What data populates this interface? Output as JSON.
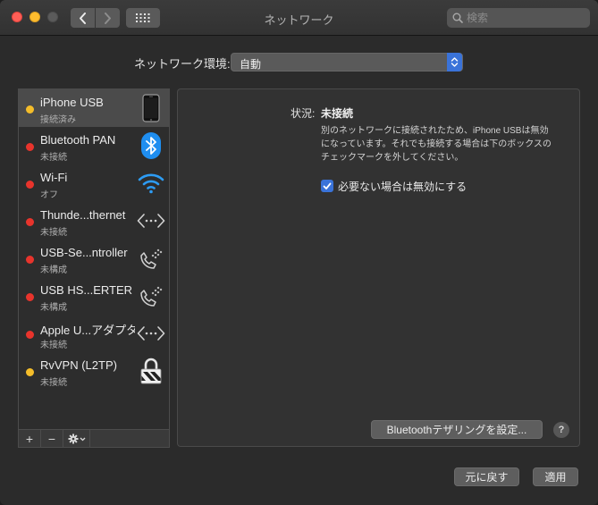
{
  "window": {
    "title": "ネットワーク"
  },
  "search": {
    "placeholder": "検索"
  },
  "location": {
    "label": "ネットワーク環境:",
    "value": "自動"
  },
  "services": [
    {
      "name": "iPhone USB",
      "status": "接続済み",
      "dot_color": "#f4bd2a",
      "icon": "iphone-icon"
    },
    {
      "name": "Bluetooth PAN",
      "status": "未接続",
      "dot_color": "#e8342c",
      "icon": "bluetooth-icon"
    },
    {
      "name": "Wi-Fi",
      "status": "オフ",
      "dot_color": "#e8342c",
      "icon": "wifi-icon"
    },
    {
      "name": "Thunde...thernet",
      "status": "未接続",
      "dot_color": "#e8342c",
      "icon": "ethernet-icon"
    },
    {
      "name": "USB-Se...ntroller",
      "status": "未構成",
      "dot_color": "#e8342c",
      "icon": "phone-modem-icon"
    },
    {
      "name": "USB HS...ERTER",
      "status": "未構成",
      "dot_color": "#e8342c",
      "icon": "phone-modem-icon"
    },
    {
      "name": "Apple U...アダプタ",
      "status": "未接続",
      "dot_color": "#e8342c",
      "icon": "ethernet-icon"
    },
    {
      "name": "RvVPN (L2TP)",
      "status": "未接続",
      "dot_color": "#f4bd2a",
      "icon": "vpn-lock-icon"
    }
  ],
  "list_toolbar": {
    "add": "+",
    "remove": "−"
  },
  "detail": {
    "status_label": "状況:",
    "status_value": "未接続",
    "status_description": "別のネットワークに接続されたため、iPhone USBは無効になっています。それでも接続する場合は下のボックスのチェックマークを外してください。",
    "checkbox_label": "必要ない場合は無効にする",
    "checkbox_checked": true,
    "tether_button": "Bluetoothテザリングを設定...",
    "help": "?"
  },
  "footer": {
    "revert": "元に戻す",
    "apply": "適用"
  }
}
